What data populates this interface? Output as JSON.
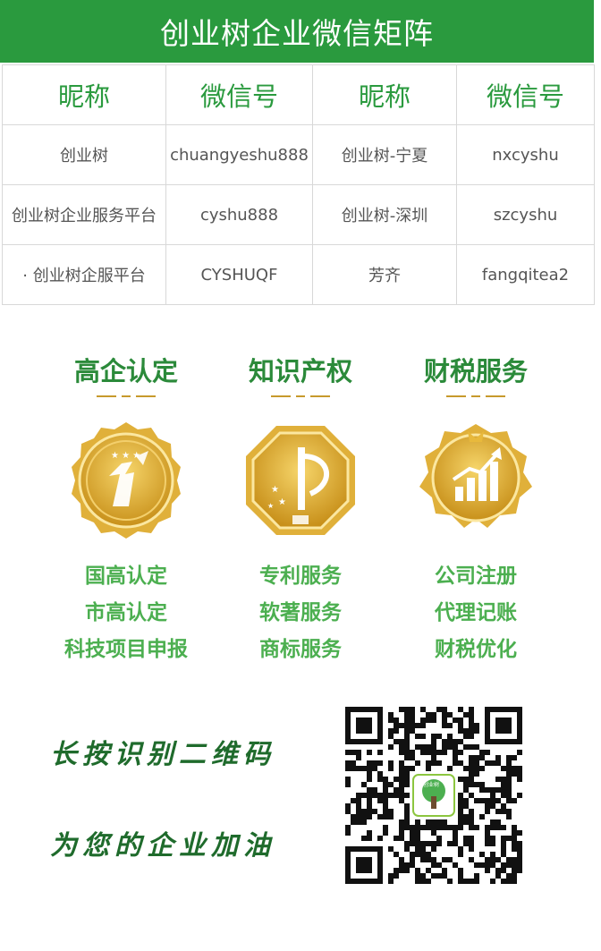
{
  "header": {
    "title": "创业树企业微信矩阵"
  },
  "table": {
    "headers": [
      "昵称",
      "微信号",
      "昵称",
      "微信号"
    ],
    "rows": [
      [
        "创业树",
        "chuangyeshu888",
        "创业树-宁夏",
        "nxcyshu"
      ],
      [
        "创业树企业服务平台",
        "cyshu888",
        "创业树-深圳",
        "szcyshu"
      ],
      [
        "· 创业树企服平台",
        "CYSHUQF",
        "芳齐",
        "fangqitea2"
      ]
    ]
  },
  "services": [
    {
      "title": "高企认定",
      "items": [
        "国高认定",
        "市高认定",
        "科技项目申报"
      ],
      "icon": "high-tech-badge-icon"
    },
    {
      "title": "知识产权",
      "items": [
        "专利服务",
        "软著服务",
        "商标服务"
      ],
      "icon": "ip-badge-icon"
    },
    {
      "title": "财税服务",
      "items": [
        "公司注册",
        "代理记账",
        "财税优化"
      ],
      "icon": "finance-badge-icon"
    }
  ],
  "footer": {
    "slogan_line1": "长按识别二维码",
    "slogan_line2": "为您的企业加油",
    "qr_center_label": "创业树"
  },
  "colors": {
    "brand_green": "#2a9a3e",
    "item_green": "#4caf50",
    "gold": "#d9a520"
  }
}
